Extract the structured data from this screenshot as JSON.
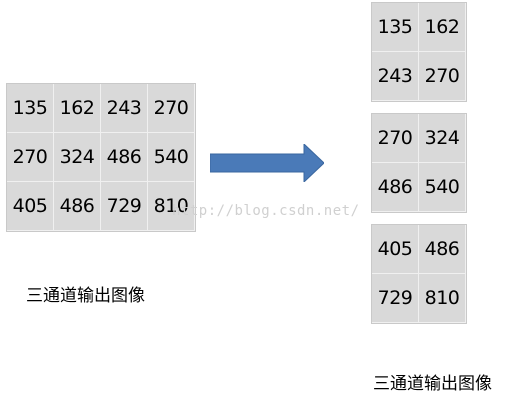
{
  "left_grid": {
    "rows": [
      [
        "135",
        "162",
        "243",
        "270"
      ],
      [
        "270",
        "324",
        "486",
        "540"
      ],
      [
        "405",
        "486",
        "729",
        "810"
      ]
    ]
  },
  "left_caption": "三通道输出图像",
  "right_grids": [
    {
      "rows": [
        [
          "135",
          "162"
        ],
        [
          "243",
          "270"
        ]
      ]
    },
    {
      "rows": [
        [
          "270",
          "324"
        ],
        [
          "486",
          "540"
        ]
      ]
    },
    {
      "rows": [
        [
          "405",
          "486"
        ],
        [
          "729",
          "810"
        ]
      ]
    }
  ],
  "right_caption": "三通道输出图像",
  "watermark": "http://blog.csdn.net/",
  "colors": {
    "cell_bg": "#d9d9d9",
    "arrow": "#4a7ab8"
  },
  "icons": {
    "arrow": "right-arrow-icon"
  }
}
